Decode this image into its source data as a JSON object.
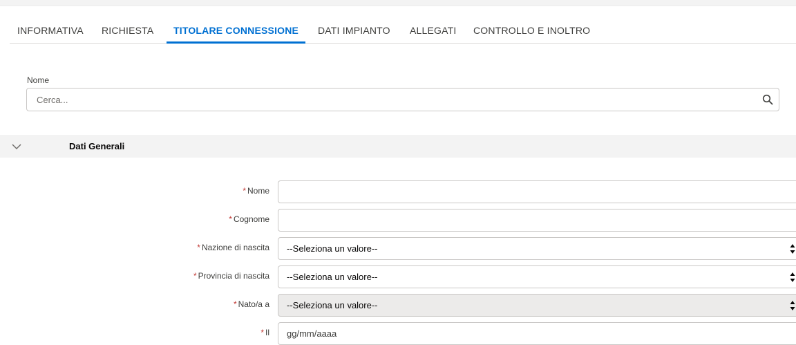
{
  "tabs": [
    {
      "label": "INFORMATIVA",
      "active": false
    },
    {
      "label": "RICHIESTA",
      "active": false
    },
    {
      "label": "TITOLARE CONNESSIONE",
      "active": true
    },
    {
      "label": "DATI IMPIANTO",
      "active": false
    },
    {
      "label": "ALLEGATI",
      "active": false
    },
    {
      "label": "CONTROLLO E INOLTRO",
      "active": false
    }
  ],
  "search": {
    "label": "Nome",
    "placeholder": "Cerca...",
    "icon": "search-icon"
  },
  "section": {
    "title": "Dati Generali",
    "icon": "chevron-down-icon"
  },
  "form": {
    "required_marker": "*",
    "nome": {
      "label": "Nome",
      "value": ""
    },
    "cognome": {
      "label": "Cognome",
      "value": ""
    },
    "nazione": {
      "label": "Nazione di nascita",
      "value": "--Seleziona un valore--"
    },
    "provincia": {
      "label": "Provincia di nascita",
      "value": "--Seleziona un valore--"
    },
    "nato": {
      "label": "Nato/a a",
      "value": "--Seleziona un valore--",
      "disabled": true
    },
    "il": {
      "label": "Il",
      "placeholder": "gg/mm/aaaa"
    }
  },
  "colors": {
    "accent": "#0070d2",
    "required": "#c23934",
    "section_bg": "#f3f3f3",
    "border": "#c9c7c5"
  }
}
